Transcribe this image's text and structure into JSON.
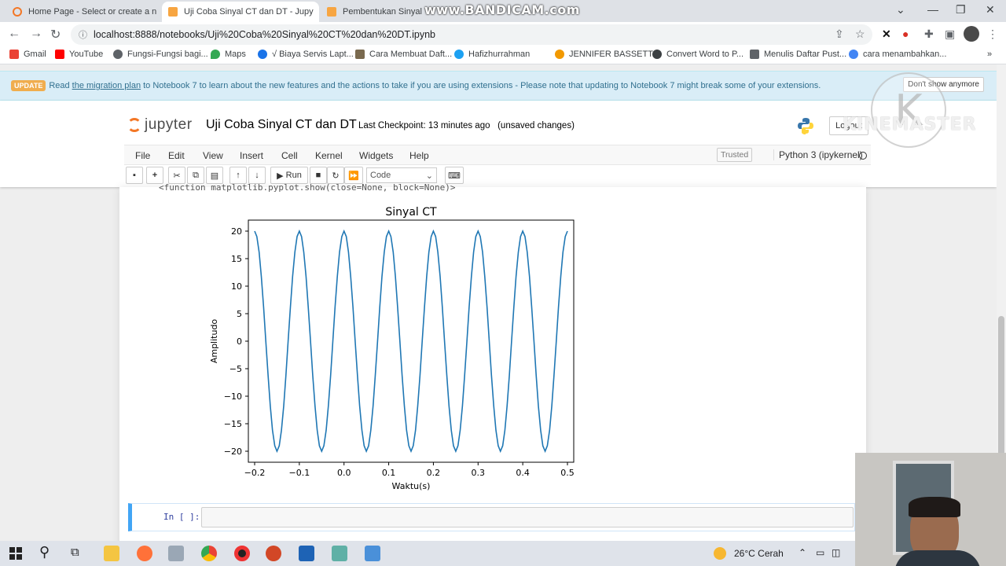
{
  "browser": {
    "tabs": [
      {
        "title": "Home Page - Select or create a n",
        "active": false
      },
      {
        "title": "Uji Coba Sinyal CT dan DT - Jupy",
        "active": true
      },
      {
        "title": "Pembentukan Sinyal CT",
        "active": false
      }
    ],
    "watermark": "www.BANDICAM.com",
    "url": "localhost:8888/notebooks/Uji%20Coba%20Sinyal%20CT%20dan%20DT.ipynb",
    "bookmarks": [
      "Gmail",
      "YouTube",
      "Fungsi-Fungsi bagi...",
      "Maps",
      "√ Biaya Servis Lapt...",
      "Cara Membuat Daft...",
      "Hafizhurrahman",
      "JENNIFER BASSETT...",
      "Convert Word to P...",
      "Menulis Daftar Pust...",
      "cara menambahkan..."
    ]
  },
  "notice": {
    "badge": "UPDATE",
    "text_before": "Read",
    "link": "the migration plan",
    "text_after": "to Notebook 7 to learn about the new features and the actions to take if you are using extensions - Please note that updating to Notebook 7 might break some of your extensions.",
    "dismiss": "Don't show anymore"
  },
  "jupyter": {
    "logo_text": "jupyter",
    "notebook_title": "Uji Coba Sinyal CT dan DT",
    "checkpoint": "Last Checkpoint: 13 minutes ago",
    "unsaved": "(unsaved changes)",
    "logout": "Logout",
    "kinemaster": "KINEMASTER",
    "menus": [
      "File",
      "Edit",
      "View",
      "Insert",
      "Cell",
      "Kernel",
      "Widgets",
      "Help"
    ],
    "trusted": "Trusted",
    "kernel": "Python 3 (ipykernel)",
    "run_label": "Run",
    "cell_type": "Code",
    "prev_output": "<function matplotlib.pyplot.show(close=None, block=None)>",
    "empty_prompt": "In [ ]:"
  },
  "chart_data": {
    "type": "line",
    "title": "Sinyal CT",
    "xlabel": "Waktu(s)",
    "ylabel": "Amplitudo",
    "xlim": [
      -0.2,
      0.5
    ],
    "ylim": [
      -20,
      20
    ],
    "xticks": [
      "−0.2",
      "−0.1",
      "0.0",
      "0.1",
      "0.2",
      "0.3",
      "0.4",
      "0.5"
    ],
    "yticks": [
      "20",
      "15",
      "10",
      "5",
      "0",
      "−5",
      "−10",
      "−15",
      "−20"
    ],
    "function": "20*cos(2*pi*10*t)",
    "amplitude": 20,
    "frequency_hz": 10,
    "color": "#1f77b4"
  },
  "taskbar": {
    "weather": "26°C  Cerah"
  }
}
